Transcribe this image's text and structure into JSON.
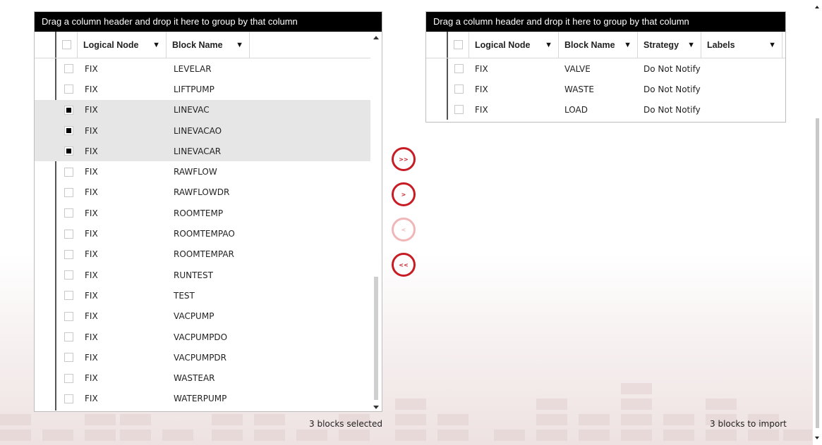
{
  "left_grid": {
    "group_panel_text": "Drag a column header and drop it here to group by that column",
    "columns": [
      "Logical Node",
      "Block Name"
    ],
    "filter_icon": "funnel-icon",
    "rows": [
      {
        "checked": false,
        "node": "FIX",
        "block": "LEVELAR"
      },
      {
        "checked": false,
        "node": "FIX",
        "block": "LIFTPUMP"
      },
      {
        "checked": true,
        "node": "FIX",
        "block": "LINEVAC"
      },
      {
        "checked": true,
        "node": "FIX",
        "block": "LINEVACAO"
      },
      {
        "checked": true,
        "node": "FIX",
        "block": "LINEVACAR"
      },
      {
        "checked": false,
        "node": "FIX",
        "block": "RAWFLOW"
      },
      {
        "checked": false,
        "node": "FIX",
        "block": "RAWFLOWDR"
      },
      {
        "checked": false,
        "node": "FIX",
        "block": "ROOMTEMP"
      },
      {
        "checked": false,
        "node": "FIX",
        "block": "ROOMTEMPAO"
      },
      {
        "checked": false,
        "node": "FIX",
        "block": "ROOMTEMPAR"
      },
      {
        "checked": false,
        "node": "FIX",
        "block": "RUNTEST"
      },
      {
        "checked": false,
        "node": "FIX",
        "block": "TEST"
      },
      {
        "checked": false,
        "node": "FIX",
        "block": "VACPUMP"
      },
      {
        "checked": false,
        "node": "FIX",
        "block": "VACPUMPDO"
      },
      {
        "checked": false,
        "node": "FIX",
        "block": "VACPUMPDR"
      },
      {
        "checked": false,
        "node": "FIX",
        "block": "WASTEAR"
      },
      {
        "checked": false,
        "node": "FIX",
        "block": "WATERPUMP"
      }
    ],
    "status": "3 blocks selected"
  },
  "right_grid": {
    "group_panel_text": "Drag a column header and drop it here to group by that column",
    "columns": [
      "Logical Node",
      "Block Name",
      "Strategy",
      "Labels"
    ],
    "rows": [
      {
        "checked": false,
        "node": "FIX",
        "block": "VALVE",
        "strategy": "Do Not Notify",
        "labels": ""
      },
      {
        "checked": false,
        "node": "FIX",
        "block": "WASTE",
        "strategy": "Do Not Notify",
        "labels": ""
      },
      {
        "checked": false,
        "node": "FIX",
        "block": "LOAD",
        "strategy": "Do Not Notify",
        "labels": ""
      }
    ],
    "status": "3 blocks to import"
  },
  "move_buttons": [
    {
      "name": "move-all-right-button",
      "label": ">>",
      "enabled": true
    },
    {
      "name": "move-selected-right-button",
      "label": ">",
      "enabled": true
    },
    {
      "name": "move-selected-left-button",
      "label": "<",
      "enabled": false
    },
    {
      "name": "move-all-left-button",
      "label": "<<",
      "enabled": true
    }
  ],
  "colors": {
    "accent_red": "#c81c24",
    "accent_red_disabled": "#f0b6b8",
    "group_panel_bg": "#000000",
    "selected_row_bg": "#e6e6e6"
  }
}
